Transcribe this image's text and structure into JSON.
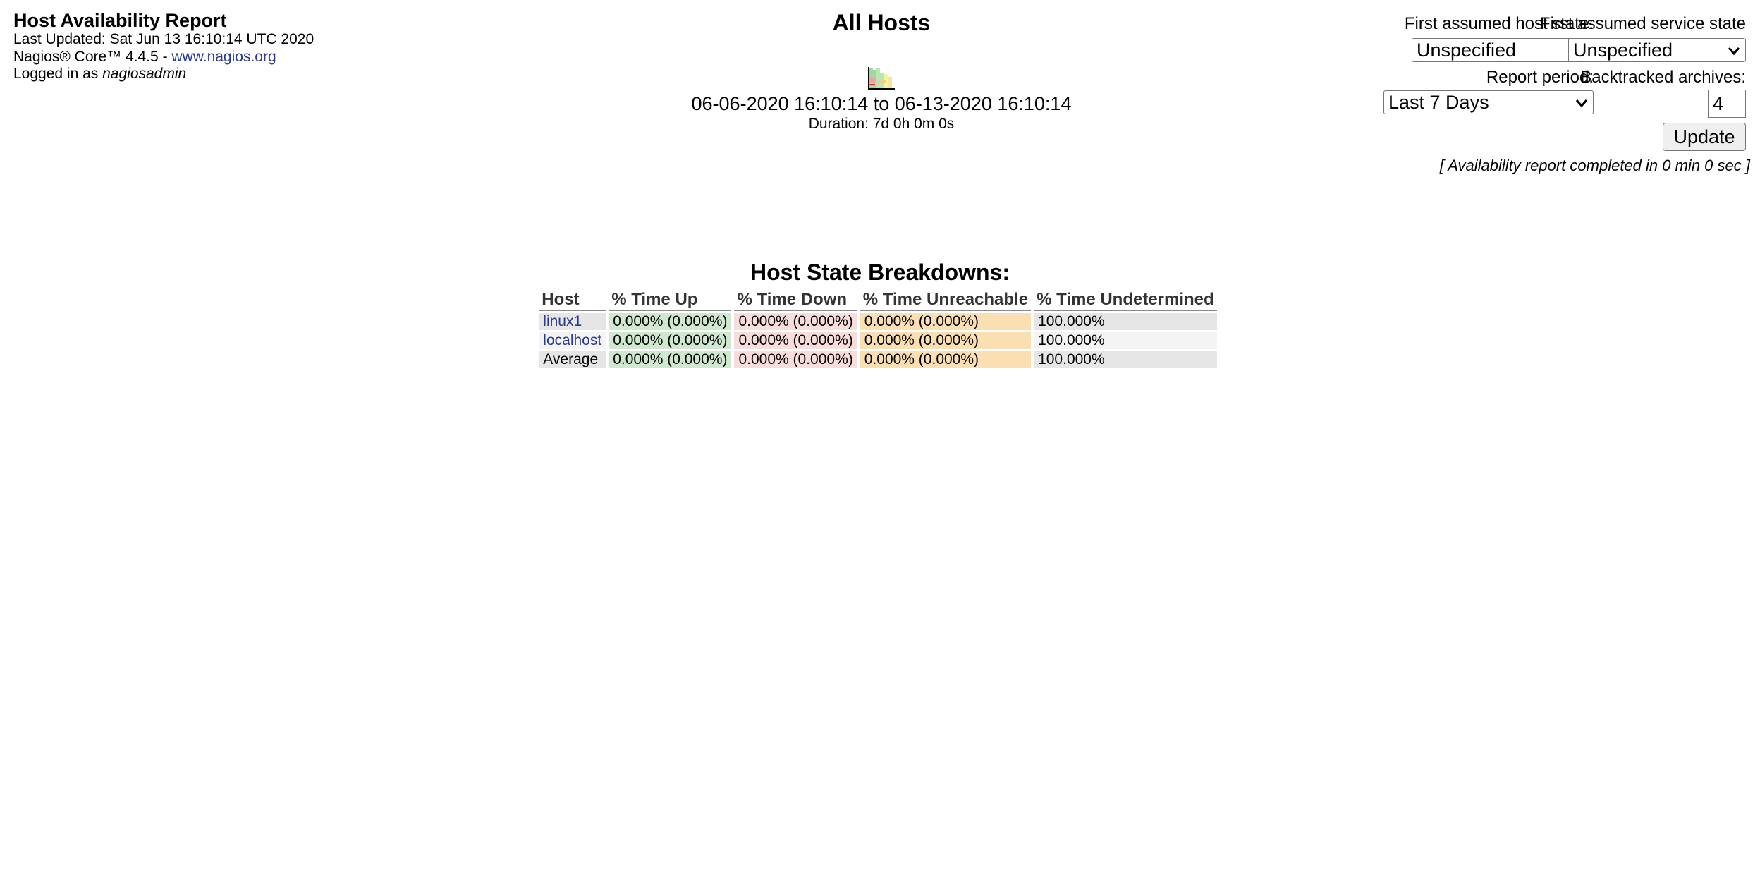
{
  "info": {
    "title": "Host Availability Report",
    "last_updated": "Last Updated: Sat Jun 13 16:10:14 UTC 2020",
    "version_prefix": "Nagios® Core™ 4.4.5 - ",
    "version_link": "www.nagios.org",
    "logged_in_prefix": "Logged in as ",
    "username": "nagiosadmin"
  },
  "header": {
    "title": "All Hosts",
    "trend_icon": "trends-icon",
    "date_range": "06-06-2020 16:10:14 to 06-13-2020 16:10:14",
    "duration": "Duration: 7d 0h 0m 0s"
  },
  "form": {
    "host_state_label": "First assumed host state:",
    "host_state_value": "Unspecified",
    "service_state_label": "First assumed service state",
    "service_state_value": "Unspecified",
    "report_period_label": "Report period:",
    "report_period_value": "Last 7 Days",
    "backtracked_label": "Backtracked archives:",
    "backtracked_value": "4",
    "update_label": "Update",
    "completed_note": "[ Availability report completed in 0 min 0 sec ]"
  },
  "breakdown": {
    "title": "Host State Breakdowns:",
    "columns": [
      "Host",
      "% Time Up",
      "% Time Down",
      "% Time Unreachable",
      "% Time Undetermined"
    ],
    "rows": [
      {
        "host": "linux1",
        "up": "0.000% (0.000%)",
        "down": "0.000% (0.000%)",
        "unreachable": "0.000% (0.000%)",
        "undetermined": "100.000%"
      },
      {
        "host": "localhost",
        "up": "0.000% (0.000%)",
        "down": "0.000% (0.000%)",
        "unreachable": "0.000% (0.000%)",
        "undetermined": "100.000%"
      },
      {
        "host": "Average",
        "up": "0.000% (0.000%)",
        "down": "0.000% (0.000%)",
        "unreachable": "0.000% (0.000%)",
        "undetermined": "100.000%"
      }
    ]
  },
  "colors": {
    "link": "#2b3a8c",
    "up_bg": "#cfe8cf",
    "down_bg": "#f9dcdc",
    "unreachable_bg": "#f9dfb2",
    "row_odd_bg": "#e6e6e6",
    "row_even_bg": "#f4f4f4"
  }
}
